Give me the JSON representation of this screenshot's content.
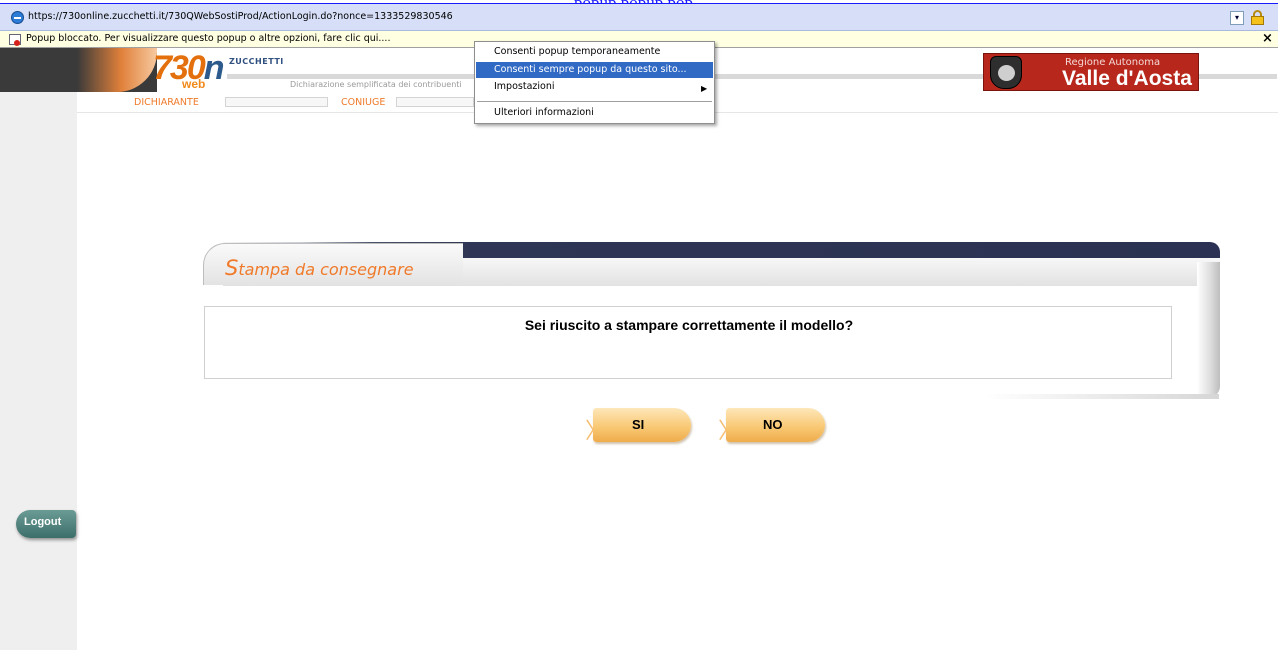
{
  "page_top_text": "popup popup pop",
  "browser": {
    "url": "https://730online.zucchetti.it/730QWebSostiProd/ActionLogin.do?nonce=1333529830546",
    "infobar_message": "Popup bloccato. Per visualizzare questo popup o altre opzioni, fare clic qui....",
    "infobar_close": "×",
    "dropdown_glyph": "▾"
  },
  "popup_menu": {
    "items": [
      "Consenti popup temporaneamente",
      "Consenti sempre popup da questo sito...",
      "Impostazioni",
      "Ulteriori informazioni"
    ],
    "highlighted_index": 1,
    "submenu_arrow": "▶"
  },
  "header": {
    "logo_main": "730",
    "logo_on": "n",
    "logo_web": "web",
    "brand_small": "ZUCCHETTI",
    "subtitle": "Dichiarazione semplificata dei contribuenti",
    "region_line1": "Regione Autonoma",
    "region_line2": "Valle d'Aosta"
  },
  "fields": {
    "dichiarante_label": "DICHIARANTE",
    "coniuge_label": "CONIUGE"
  },
  "panel": {
    "title_initial": "S",
    "title_rest": "tampa da consegnare",
    "question": "Sei riuscito a stampare correttamente il modello?"
  },
  "buttons": {
    "yes_label": "SI",
    "no_label": "NO",
    "chevron": "〉"
  },
  "logout_label": "Logout",
  "colors": {
    "accent_orange": "#f07a2a",
    "menu_highlight": "#316ac5",
    "region_red": "#b8271c",
    "header_dark_blue": "#2f3655",
    "logout_teal": "#3d6f6a",
    "button_orange": "#f9c975"
  },
  "icons": {
    "address_bar": "ie-page-icon",
    "security": "lock-icon",
    "infobar": "popup-blocked-icon",
    "region": "aosta-coat-of-arms"
  }
}
